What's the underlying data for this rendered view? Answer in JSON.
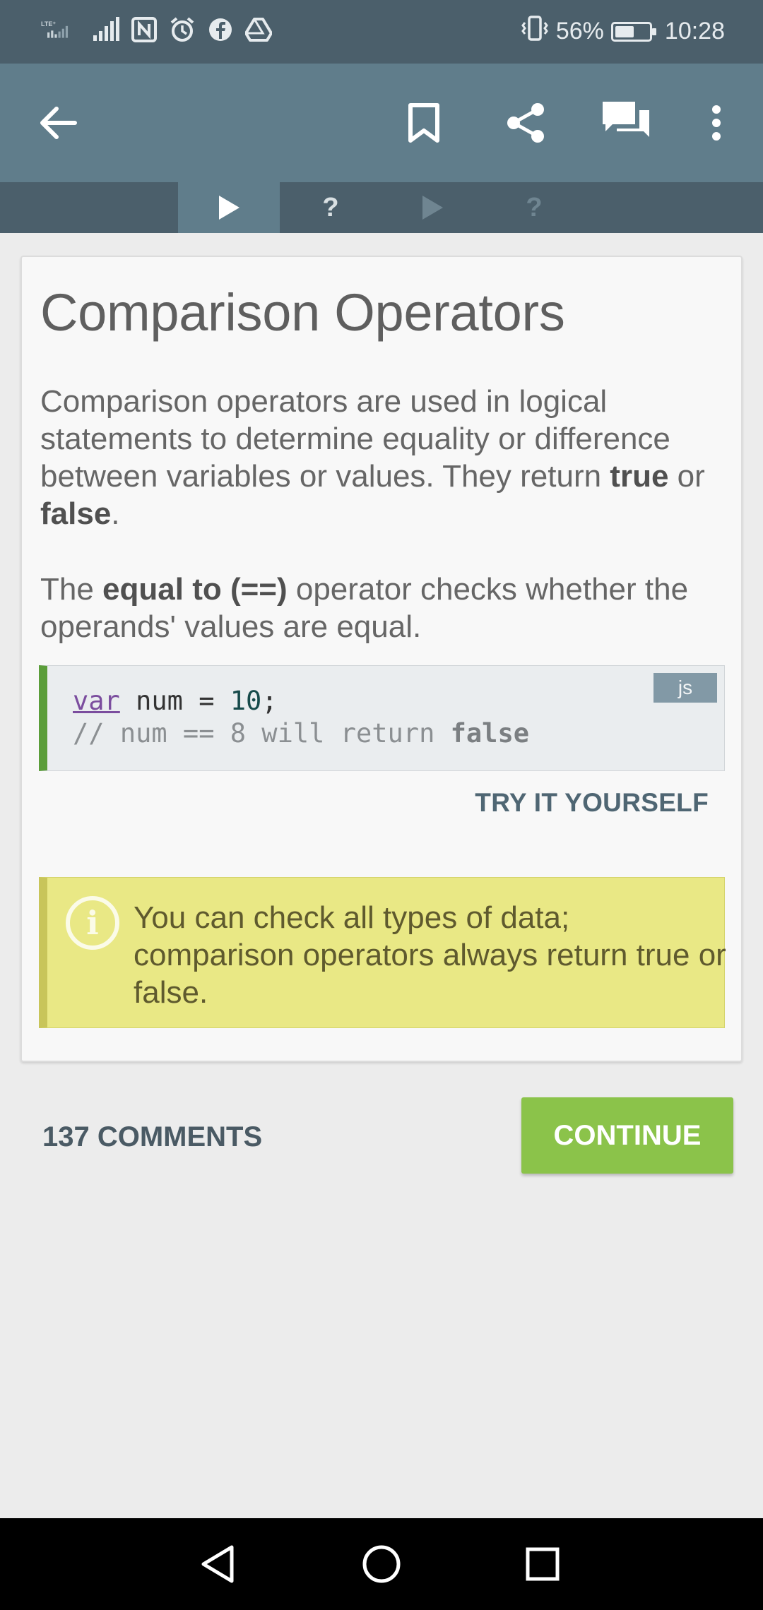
{
  "status_bar": {
    "network_label": "LTE⁺",
    "battery_percent": "56%",
    "battery_level": 0.56,
    "time": "10:28",
    "icons": [
      "lte-signal-icon",
      "signal-icon",
      "nfc-icon",
      "alarm-icon",
      "facebook-icon",
      "drive-icon",
      "vibrate-icon",
      "battery-icon"
    ]
  },
  "app_bar": {
    "icons": [
      "back-arrow-icon",
      "bookmark-icon",
      "share-icon",
      "comments-icon",
      "more-vert-icon"
    ]
  },
  "steps": [
    {
      "symbol": "",
      "type": "play",
      "active": true
    },
    {
      "symbol": "?",
      "type": "quiz",
      "active": false
    },
    {
      "symbol": "",
      "type": "play",
      "active": false
    },
    {
      "symbol": "?",
      "type": "quiz",
      "active": false
    }
  ],
  "lesson": {
    "title": "Comparison Operators",
    "para1_text": "Comparison operators are used in logical statements to determine equality or difference between variables or values. They return ",
    "para1_true": "true",
    "para1_or": " or ",
    "para1_false": "false",
    "para1_end": ".",
    "para2_start": "The ",
    "para2_bold": "equal to (==)",
    "para2_rest": " operator checks whether the operands' values are equal.",
    "code": {
      "language": "js",
      "line1_kw": "var",
      "line1_mid": " num = ",
      "line1_num": "10",
      "line1_end": ";",
      "line2_text": "// num == 8 will return ",
      "line2_strong": "false"
    },
    "try_label": "TRY IT YOURSELF",
    "note_text": "You can check all types of data; comparison operators always return true or false."
  },
  "footer": {
    "comments_label": "137 COMMENTS",
    "continue_label": "CONTINUE"
  },
  "colors": {
    "status_bar": "#4b5f6b",
    "app_bar": "#607d8b",
    "accent_green": "#8bc34a",
    "code_border": "#5b9e3a",
    "note_bg": "#e9e885"
  }
}
